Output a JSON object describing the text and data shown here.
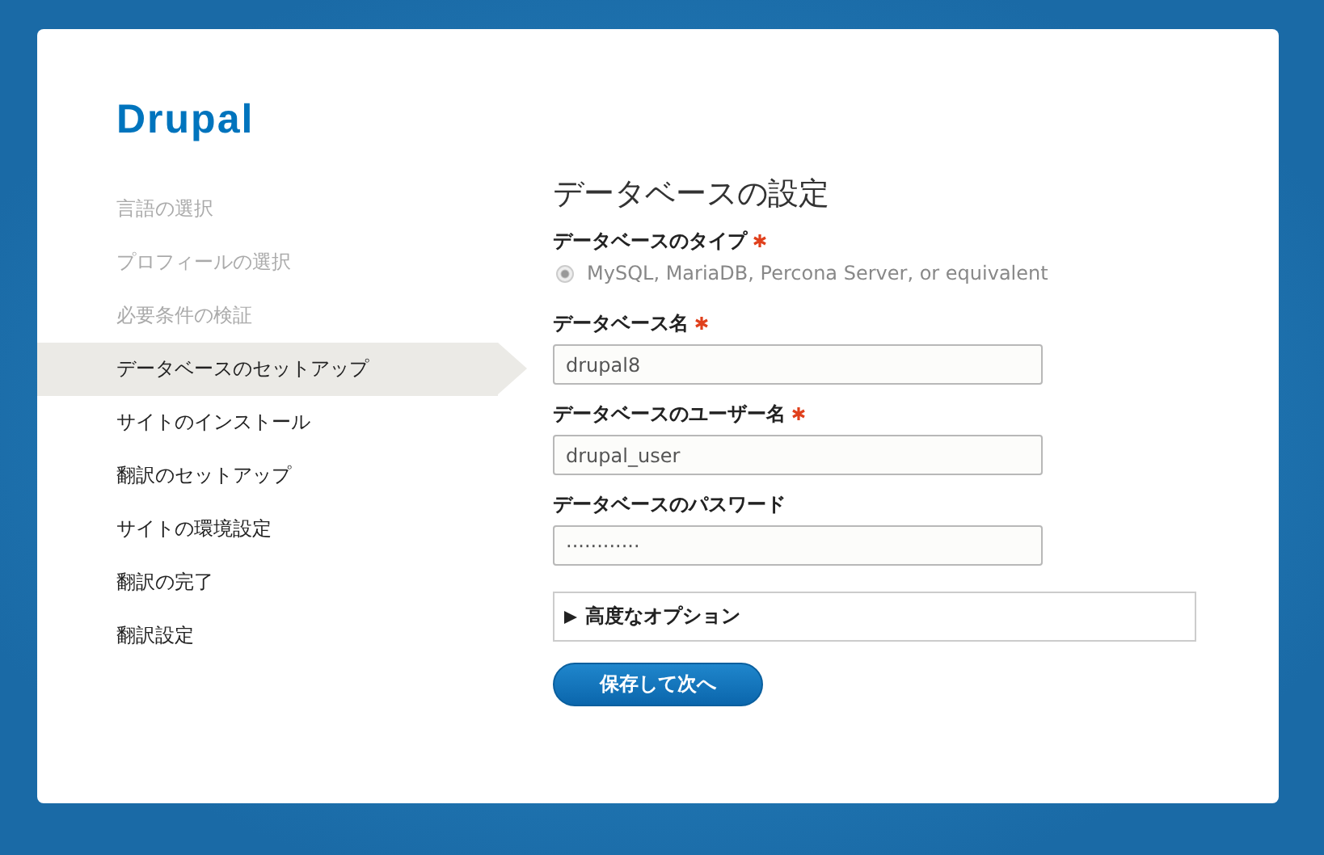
{
  "logo": "Drupal",
  "steps": [
    {
      "label": "言語の選択",
      "done": true,
      "selected": false
    },
    {
      "label": "プロフィールの選択",
      "done": true,
      "selected": false
    },
    {
      "label": "必要条件の検証",
      "done": true,
      "selected": false
    },
    {
      "label": "データベースのセットアップ",
      "done": false,
      "selected": true
    },
    {
      "label": "サイトのインストール",
      "done": false,
      "selected": false
    },
    {
      "label": "翻訳のセットアップ",
      "done": false,
      "selected": false
    },
    {
      "label": "サイトの環境設定",
      "done": false,
      "selected": false
    },
    {
      "label": "翻訳の完了",
      "done": false,
      "selected": false
    },
    {
      "label": "翻訳設定",
      "done": false,
      "selected": false
    }
  ],
  "heading": "データベースの設定",
  "fields": [
    {
      "kind": "radio",
      "label": "データベースのタイプ",
      "required": true,
      "option": "MySQL, MariaDB, Percona Server, or equivalent",
      "selected": true,
      "disabled": true
    },
    {
      "kind": "text",
      "label": "データベース名",
      "required": true,
      "value": "drupal8"
    },
    {
      "kind": "text",
      "label": "データベースのユーザー名",
      "required": true,
      "value": "drupal_user"
    },
    {
      "kind": "text",
      "label": "データベースのパスワード",
      "required": false,
      "value": "············"
    }
  ],
  "advanced": {
    "label": "高度なオプション",
    "expanded": false
  },
  "submit": "保存して次へ"
}
